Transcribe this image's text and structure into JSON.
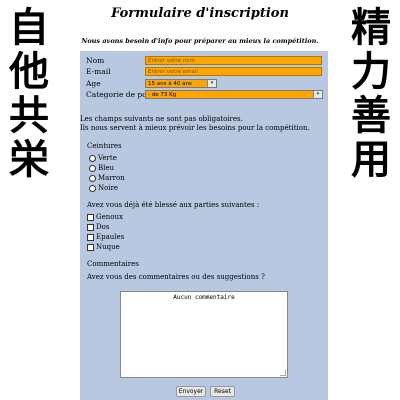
{
  "decor": {
    "left_kanji": [
      "自",
      "他",
      "共",
      "栄"
    ],
    "right_kanji": [
      "精",
      "力",
      "善",
      "用"
    ]
  },
  "header": {
    "title": "Formulaire d'inscription",
    "subtitle": "Nous avons besoin d'info pour préparer au mieux la compétition."
  },
  "form": {
    "nom": {
      "label": "Nom",
      "placeholder": "Entrer votre nom"
    },
    "email": {
      "label": "E-mail",
      "placeholder": "Entrer votre email"
    },
    "age": {
      "label": "Age",
      "value": "15 ans à 40 ans"
    },
    "categorie": {
      "label": "Categorie de poids",
      "value": "- de 73 Kg"
    },
    "note_line1": "Les champs suivants ne sont pas obligatoires.",
    "note_line2": "Ils nous servent à mieux prévoir les besoins pour la compétition.",
    "ceintures": {
      "label": "Ceintures",
      "options": [
        "Verte",
        "Bleu",
        "Marron",
        "Noire"
      ]
    },
    "blessures": {
      "label": "Avez vous déjà été blessé aux parties suivantes :",
      "options": [
        "Genoux",
        "Dos",
        "Epaules",
        "Nuque"
      ]
    },
    "commentaires": {
      "label": "Commentaires",
      "question": "Avez vous des commentaires ou des suggestions ?",
      "value": "Aucun commentaire"
    },
    "submit_label": "Envoyer",
    "reset_label": "Reset"
  }
}
